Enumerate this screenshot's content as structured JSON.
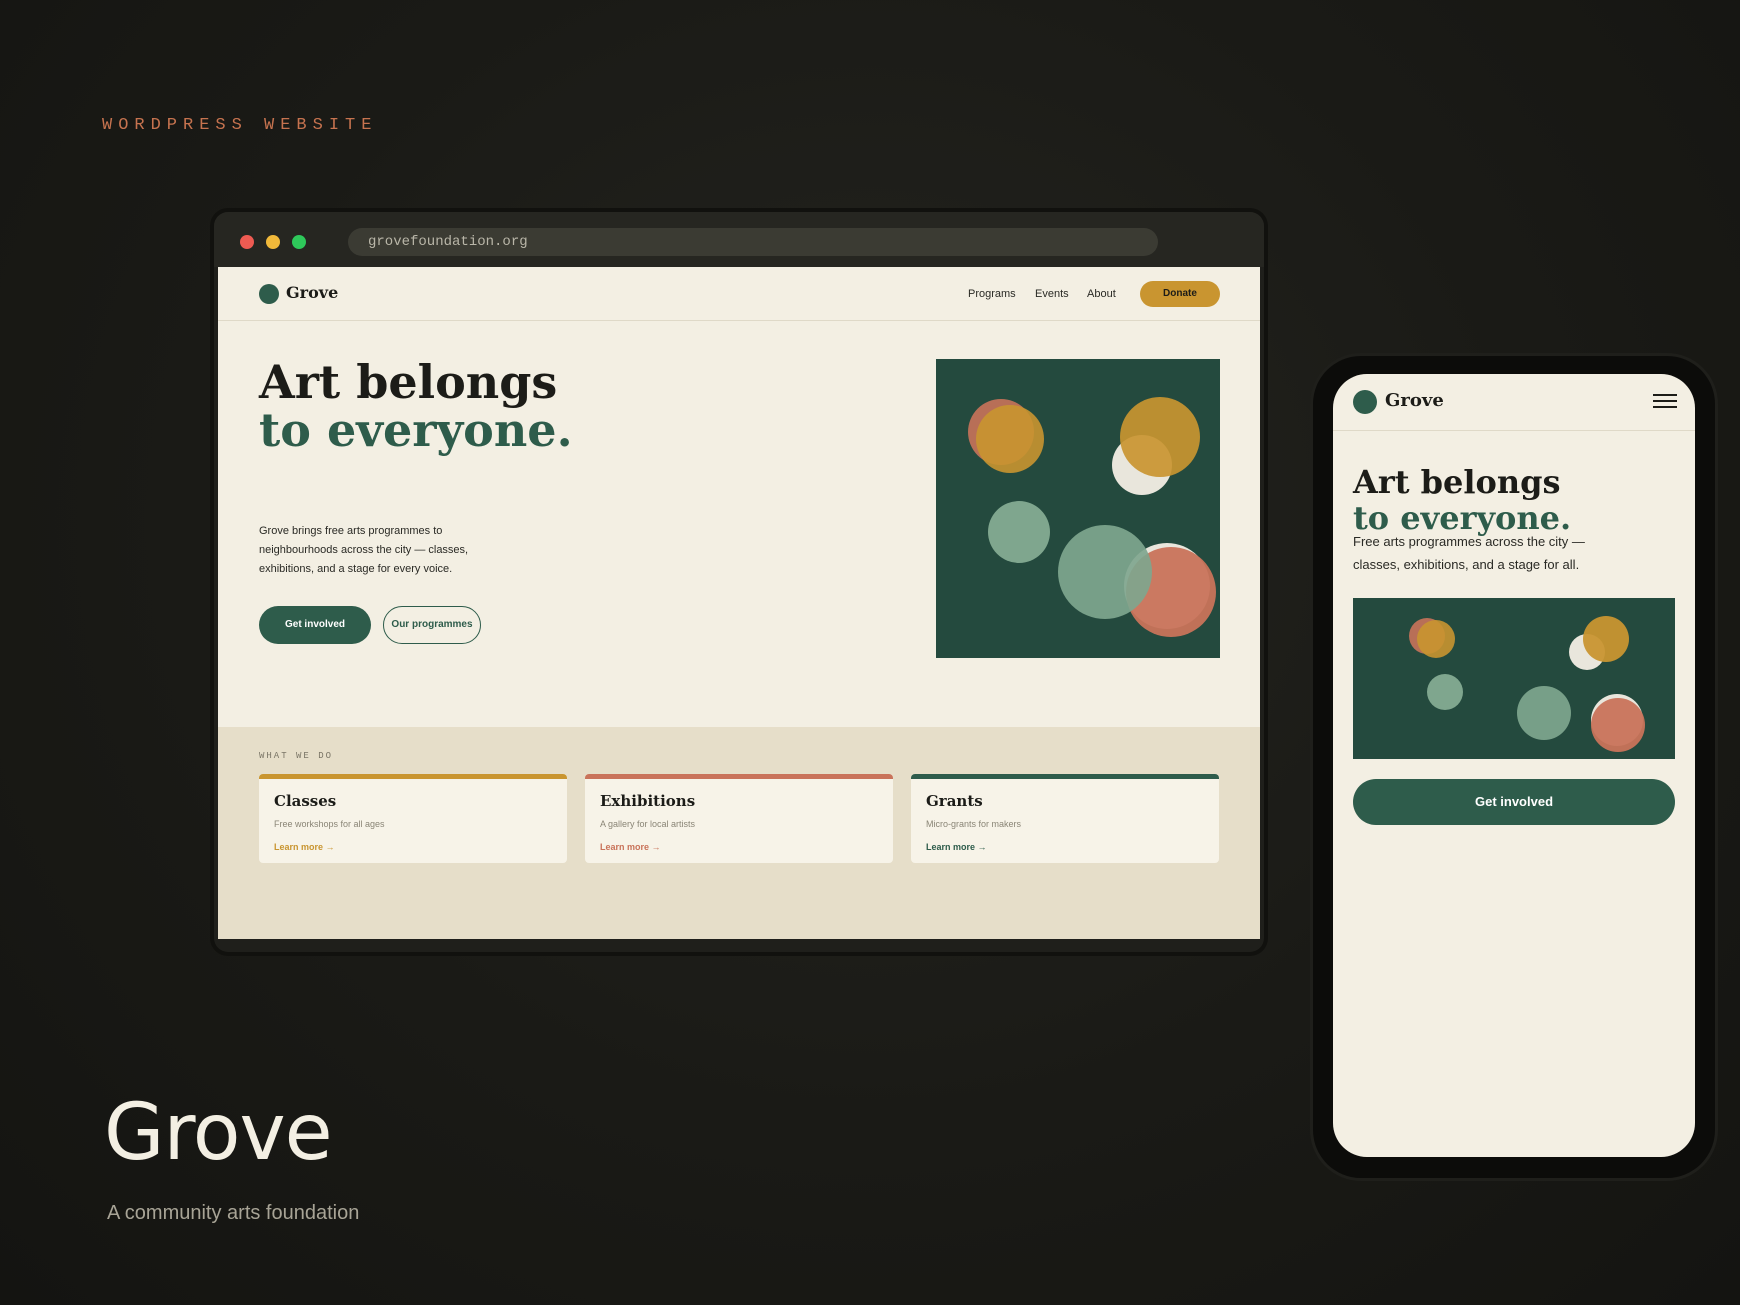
{
  "eyebrow": "WORDPRESS WEBSITE",
  "browser": {
    "url": "grovefoundation.org"
  },
  "site": {
    "logo_text": "Grove",
    "nav": [
      "Programs",
      "Events",
      "About"
    ],
    "donate_label": "Donate",
    "hero": {
      "title_line1": "Art belongs",
      "title_line2": "to everyone.",
      "body": "Grove brings free arts programmes to neighbourhoods across the city — classes, exhibitions, and a stage for every voice.",
      "primary_cta": "Get involved",
      "secondary_cta": "Our programmes"
    },
    "section_label": "WHAT WE DO",
    "cards": [
      {
        "title": "Classes",
        "subtitle": "Free workshops for all ages",
        "link": "Learn more →",
        "accent": "#c99530"
      },
      {
        "title": "Exhibitions",
        "subtitle": "A gallery for local artists",
        "link": "Learn more →",
        "accent": "#c9735a"
      },
      {
        "title": "Grants",
        "subtitle": "Micro-grants for makers",
        "link": "Learn more →",
        "accent": "#2e5c4b"
      }
    ]
  },
  "mobile": {
    "logo_text": "Grove",
    "title_line1": "Art belongs",
    "title_line2": "to everyone.",
    "body": "Free arts programmes across the city — classes, exhibitions, and a stage for all.",
    "cta": "Get involved"
  },
  "brand": {
    "name": "Grove",
    "tagline": "A community arts foundation"
  },
  "colors": {
    "forest": "#2e5c4b",
    "art_bg": "#244a3e",
    "mustard": "#c99530",
    "terracotta": "#c9735a",
    "sage": "#7fa68e",
    "cream": "#f3efe3"
  },
  "icons": [
    "menu-icon",
    "logo-dot-icon"
  ]
}
